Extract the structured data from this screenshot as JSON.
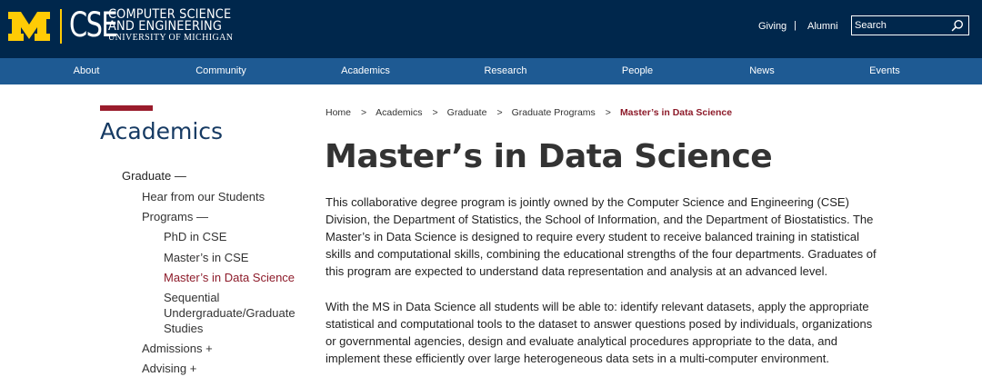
{
  "header": {
    "logo": {
      "block_m": "M",
      "cse": "CSE",
      "line1": "COMPUTER SCIENCE",
      "line2": "AND ENGINEERING",
      "line3": "UNIVERSITY OF MICHIGAN"
    },
    "utility": {
      "giving": "Giving",
      "separator": "|",
      "alumni": "Alumni"
    },
    "search": {
      "placeholder": "Search",
      "icon": "search-icon"
    },
    "colors": {
      "navy": "#00274c",
      "maize": "#ffcb05",
      "nav_blue": "#1e5a93",
      "accent": "#8d1b2a"
    }
  },
  "nav": {
    "items": [
      "About",
      "Community",
      "Academics",
      "Research",
      "People",
      "News",
      "Events"
    ]
  },
  "sidebar": {
    "title": "Academics",
    "graduate": "Graduate —",
    "hear": "Hear from our Students",
    "programs": "Programs —",
    "phd": "PhD in CSE",
    "masters_cse": "Master’s in CSE",
    "masters_ds": "Master’s in Data Science",
    "sequential_1": "Sequential",
    "sequential_2": "Undergraduate/Graduate",
    "sequential_3": "Studies",
    "admissions": "Admissions +",
    "advising": "Advising +"
  },
  "breadcrumb": {
    "items": [
      "Home",
      "Academics",
      "Graduate",
      "Graduate Programs"
    ],
    "separator": ">",
    "current": "Master’s in Data Science"
  },
  "main": {
    "title": "Master’s in Data Science",
    "paragraphs": [
      "This collaborative degree program is jointly owned by the Computer Science and Engineering (CSE) Division, the Department of Statistics, the School of Information, and the Department of Biostatistics. The Master’s in Data Science is designed to require every student to receive balanced training in statistical skills and computational skills, combining the educational strengths of the four departments. Graduates of this program are expected to understand data representation and analysis at an advanced level.",
      "With the MS in Data Science all students will be able to: identify relevant datasets, apply the appropriate statistical and computational tools to the dataset to answer questions posed by individuals, organizations or governmental agencies, design and evaluate analytical procedures appropriate to the data, and implement these efficiently over large heterogeneous data sets in a multi-computer environment."
    ]
  }
}
